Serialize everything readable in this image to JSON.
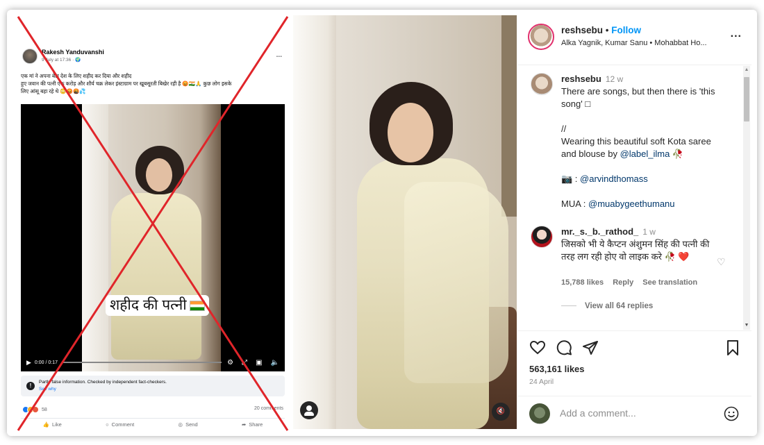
{
  "facebook_post": {
    "author": "Rakesh Yanduvanshi",
    "meta": "9 July at 17:36 · 🌍",
    "more": "...",
    "text_line1": "एक मां ने अपना बेटा देश के लिए शहीद कर दिया और शहीद",
    "text_line2": "हुए जवान की पत्नी एक करोड़ और शौर्य चक्र लेकर इंस्टाग्राम पर खूबसूरती बिखेर रही है 😡🇮🇳🙏 कुछ लोग इसके",
    "text_line3": "लिए आंसू बहा रहे थे 😳😡🤬💦",
    "video_caption": "शहीद की पत्नी",
    "video_time": "0:00 / 0:17",
    "fact_check_text": "Partly false information. Checked by independent fact-checkers.",
    "fact_check_link": "See why",
    "reactions_count": "58",
    "comments_count": "20 comments",
    "actions": [
      "Like",
      "Comment",
      "Send",
      "Share"
    ]
  },
  "instagram_post": {
    "username": "reshsebu",
    "follow_label": "Follow",
    "audio": "Alka Yagnik, Kumar Sanu • Mohabbat Ho...",
    "more": "...",
    "caption": {
      "username": "reshsebu",
      "time": "12 w",
      "line1": "There are songs, but then there is 'this",
      "line2": "song' □",
      "line3": "//",
      "line4": "Wearing this beautiful soft Kota saree",
      "line5_prefix": "and blouse by ",
      "mention_label": "@label_ilma",
      "line5_suffix": " 🥀",
      "photo_prefix": "📷 : ",
      "mention_photographer": "@arvindthomass",
      "mua_prefix": "MUA : ",
      "mention_mua": "@muabygeethumanu"
    },
    "comment": {
      "username": "mr._s._b._rathod_",
      "time": "1 w",
      "text": "जिसको भी ये कैप्टन अंशुमन सिंह की पत्नी की तरह लग रही होए वो लाइक करे 🥀 ❤️",
      "likes": "15,788 likes",
      "reply": "Reply",
      "translate": "See translation",
      "view_replies": "View all 64 replies"
    },
    "likes": "563,161 likes",
    "date": "24 April",
    "add_comment_placeholder": "Add a comment..."
  },
  "colors": {
    "cross": "#e0252a",
    "ig_link": "#0095f6",
    "fb_link": "#1877f2"
  }
}
